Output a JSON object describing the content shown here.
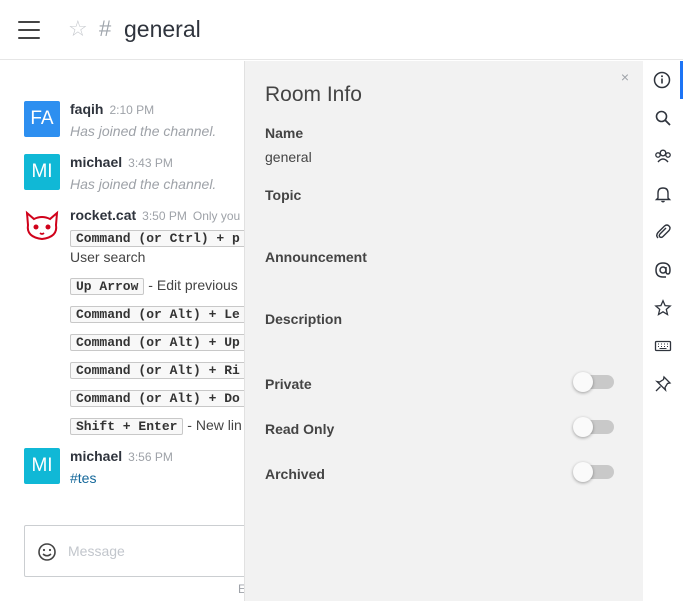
{
  "header": {
    "room_name": "general",
    "favorite_icon": "star-icon",
    "channel_icon": "hash-icon"
  },
  "messages": [
    {
      "initials": "FA",
      "avatar_color": "#2d8ff0",
      "user": "faqih",
      "time": "2:10 PM",
      "text": "Has joined the channel."
    },
    {
      "initials": "MI",
      "avatar_color": "#10b8d6",
      "user": "michael",
      "time": "3:43 PM",
      "text": "Has joined the channel."
    },
    {
      "user": "rocket.cat",
      "time": "3:50 PM",
      "note": "Only you",
      "lines": [
        {
          "key": "Command (or Ctrl) + p",
          "after": ""
        },
        {
          "key": "",
          "after": "User search"
        },
        {
          "key": "Up Arrow",
          "after": " - Edit previous"
        },
        {
          "key": "Command (or Alt) + Le",
          "after": ""
        },
        {
          "key": "Command (or Alt) + Up",
          "after": ""
        },
        {
          "key": "Command (or Alt) + Ri",
          "after": ""
        },
        {
          "key": "Command (or Alt) + Do",
          "after": ""
        },
        {
          "key": "Shift + Enter",
          "after": " - New lin"
        }
      ]
    },
    {
      "initials": "MI",
      "avatar_color": "#10b8d6",
      "user": "michael",
      "time": "3:56 PM",
      "text": "#tes"
    }
  ],
  "composer": {
    "placeholder": "Message",
    "emoji_icon": "smiley-icon",
    "footer_fragment": "E"
  },
  "room_info": {
    "title": "Room Info",
    "close_label": "×",
    "name_label": "Name",
    "name_value": "general",
    "topic_label": "Topic",
    "announcement_label": "Announcement",
    "description_label": "Description",
    "private_label": "Private",
    "read_only_label": "Read Only",
    "archived_label": "Archived",
    "toggles": {
      "private": false,
      "read_only": false,
      "archived": false
    }
  },
  "tabbar": {
    "accent": "#1d74f5",
    "icons": [
      "info-icon",
      "search-icon",
      "members-icon",
      "bell-icon",
      "paperclip-icon",
      "mention-icon",
      "star-icon",
      "keyboard-icon",
      "pin-icon"
    ]
  }
}
